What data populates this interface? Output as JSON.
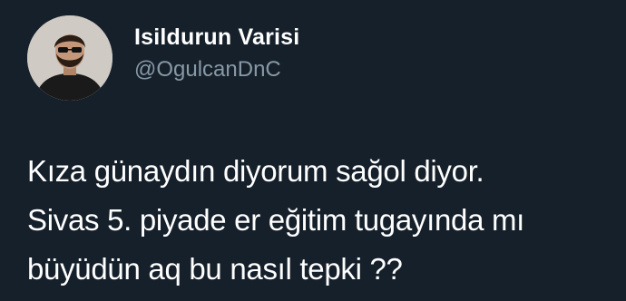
{
  "author": {
    "display_name": "Isildurun Varisi",
    "handle": "@OgulcanDnC",
    "avatar_icon": "profile-photo"
  },
  "tweet": {
    "lines": [
      "Kıza günaydın diyorum sağol diyor.",
      "Sivas 5. piyade er eğitim tugayında mı",
      "büyüdün aq bu nasıl tepki ??"
    ]
  },
  "colors": {
    "background": "#15202b",
    "name_text": "#ffffff",
    "handle_text": "#8899a6",
    "body_text": "#ffffff"
  }
}
